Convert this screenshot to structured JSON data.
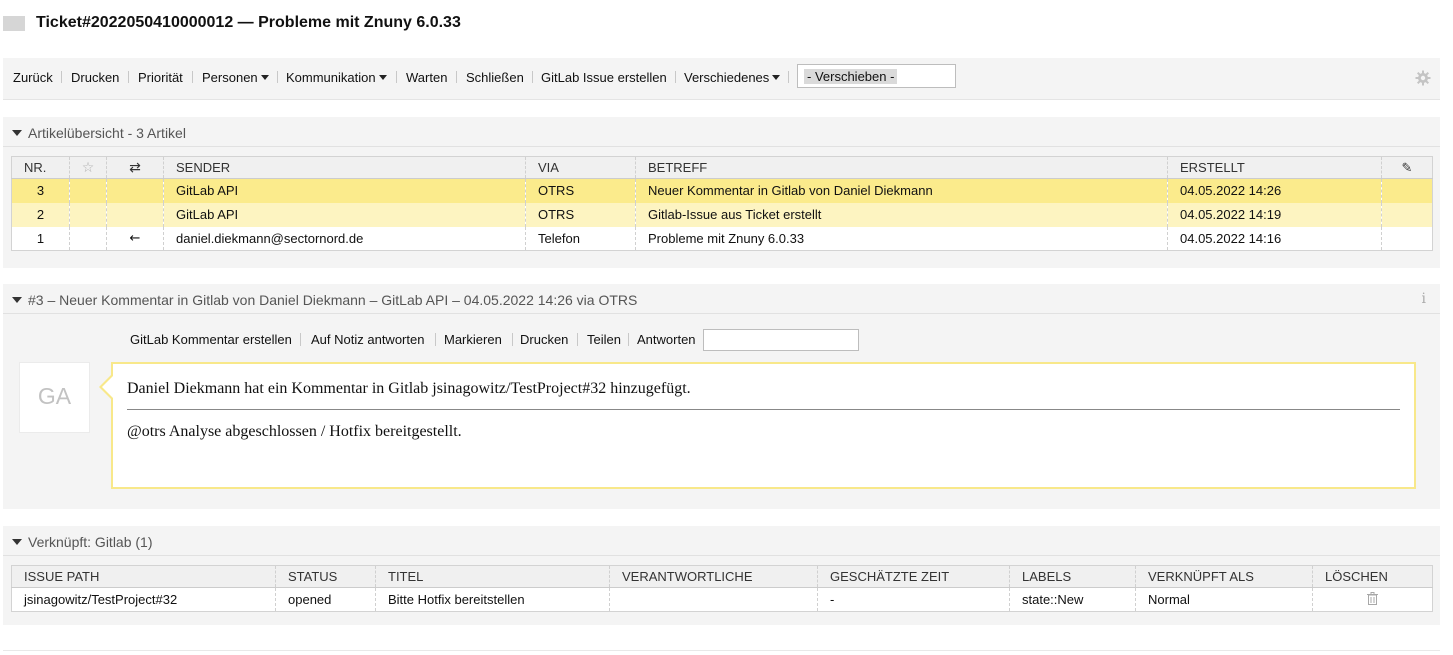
{
  "ticket": {
    "title": "Ticket#2022050410000012 — Probleme mit Znuny 6.0.33"
  },
  "toolbar": {
    "items": [
      {
        "label": "Zurück"
      },
      {
        "label": "Drucken"
      },
      {
        "label": "Priorität"
      },
      {
        "label": "Personen",
        "dropdown": true
      },
      {
        "label": "Kommunikation",
        "dropdown": true
      },
      {
        "label": "Warten"
      },
      {
        "label": "Schließen"
      },
      {
        "label": "GitLab Issue erstellen"
      },
      {
        "label": "Verschiedenes",
        "dropdown": true
      }
    ],
    "move_select": "- Verschieben -",
    "settings_icon": "gear-icon"
  },
  "articles_panel": {
    "title": "Artikelübersicht - 3 Artikel",
    "columns": [
      "NR.",
      "",
      "",
      "SENDER",
      "VIA",
      "BETREFF",
      "ERSTELLT",
      ""
    ],
    "column_icons": {
      "star": "star-icon",
      "direction": "arrows-exchange-icon",
      "attachment": "paperclip-icon"
    },
    "rows": [
      {
        "nr": "3",
        "direction": "",
        "sender": "GitLab API",
        "via": "OTRS",
        "subject": "Neuer Kommentar in Gitlab von Daniel Diekmann",
        "created": "04.05.2022 14:26",
        "state": "selected"
      },
      {
        "nr": "2",
        "direction": "",
        "sender": "GitLab API",
        "via": "OTRS",
        "subject": "Gitlab-Issue aus Ticket erstellt",
        "created": "04.05.2022 14:19",
        "state": "unread"
      },
      {
        "nr": "1",
        "direction": "←",
        "sender": "daniel.diekmann@sectornord.de",
        "via": "Telefon",
        "subject": "Probleme mit Znuny 6.0.33",
        "created": "04.05.2022 14:16",
        "state": "normal"
      }
    ],
    "colors": {
      "selected": "#fbeb8c",
      "unread": "#fdf4c1"
    }
  },
  "article": {
    "title": "#3 – Neuer Kommentar in Gitlab von Daniel Diekmann – GitLab API – 04.05.2022 14:26 via OTRS",
    "actions": [
      "GitLab Kommentar erstellen",
      "Auf Notiz antworten",
      "Markieren",
      "Drucken",
      "Teilen",
      "Antworten"
    ],
    "avatar_initials": "GA",
    "body_line1": "Daniel Diekmann hat ein Kommentar in Gitlab jsinagowitz/TestProject#32 hinzugefügt.",
    "body_line2": "@otrs Analyse abgeschlossen / Hotfix bereitgestellt."
  },
  "linked_panel": {
    "title": "Verknüpft: Gitlab (1)",
    "columns": [
      "ISSUE PATH",
      "STATUS",
      "TITEL",
      "VERANTWORTLICHE",
      "GESCHÄTZTE ZEIT",
      "LABELS",
      "VERKNÜPFT ALS",
      "LÖSCHEN"
    ],
    "rows": [
      {
        "path": "jsinagowitz/TestProject#32",
        "status": "opened",
        "title": "Bitte Hotfix bereitstellen",
        "assignee": "",
        "estimate": "-",
        "labels": "state::New",
        "linked_as": "Normal"
      }
    ],
    "link_color": "#e88b1a"
  }
}
